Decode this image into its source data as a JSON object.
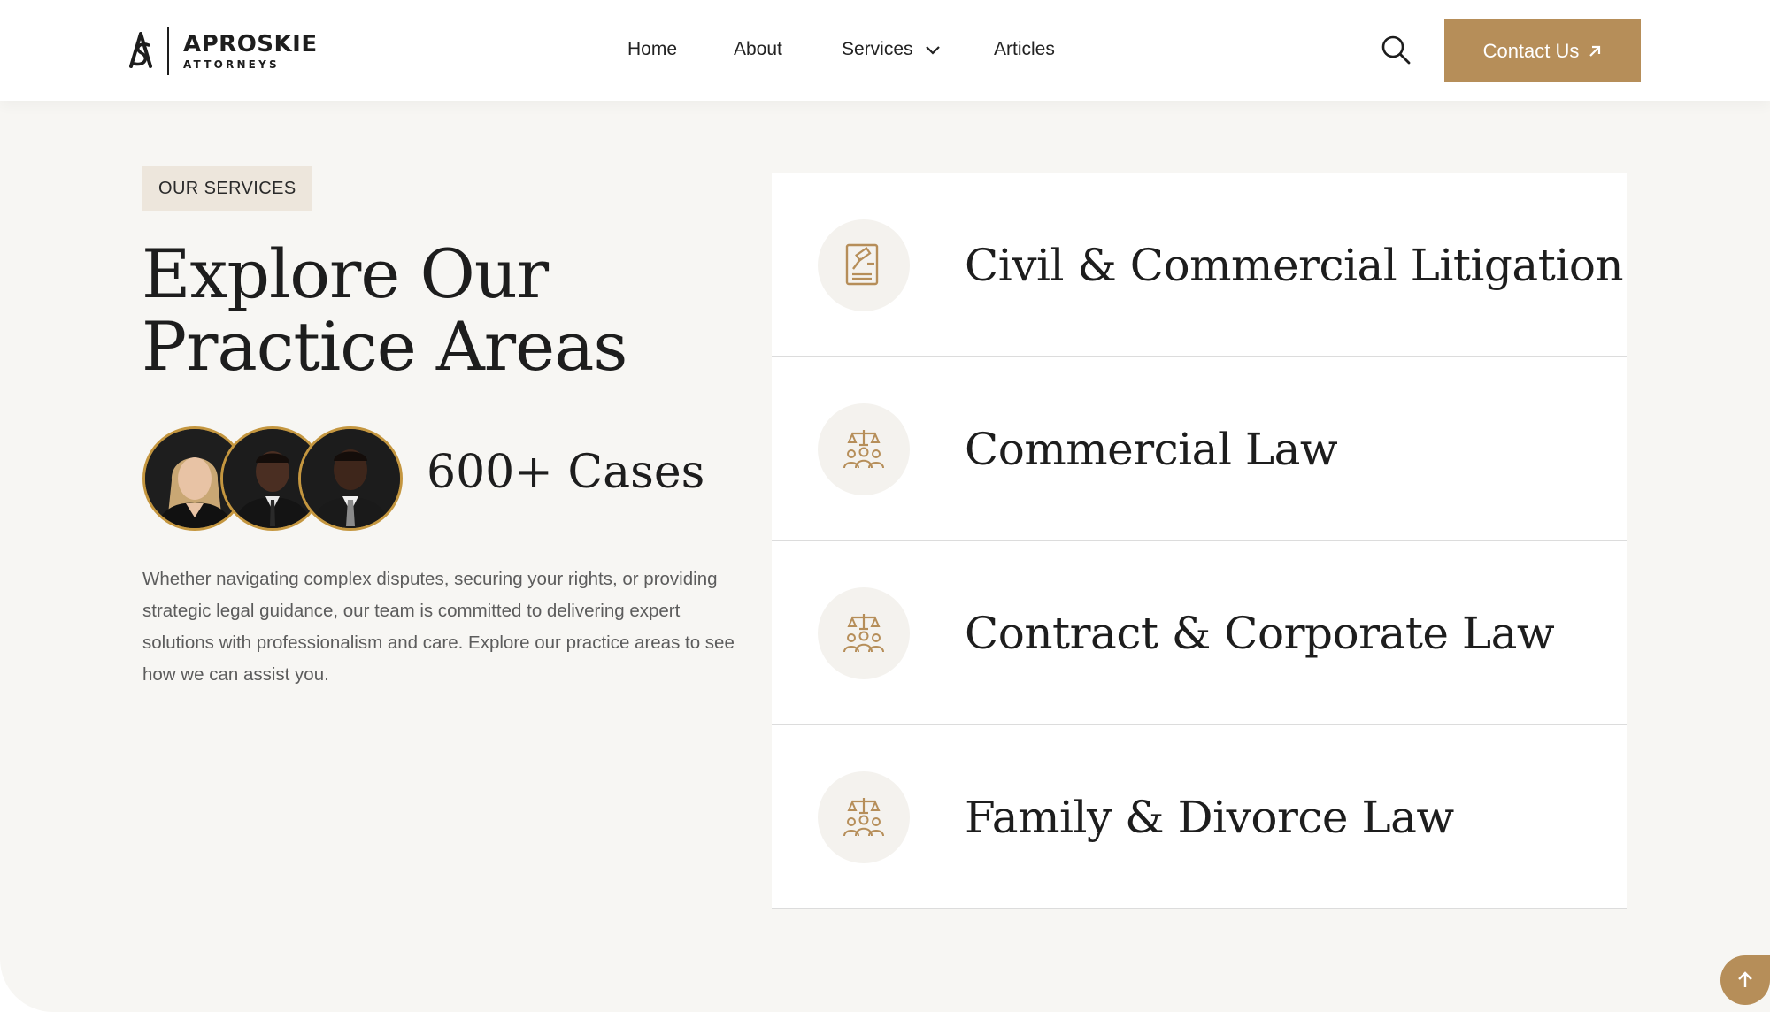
{
  "brand": {
    "name": "APROSKIE",
    "subtitle": "ATTORNEYS"
  },
  "nav": {
    "items": [
      {
        "label": "Home"
      },
      {
        "label": "About"
      },
      {
        "label": "Services"
      },
      {
        "label": "Articles"
      }
    ]
  },
  "header": {
    "contact_label": "Contact Us"
  },
  "section": {
    "tag": "OUR SERVICES",
    "heading_line1": "Explore Our",
    "heading_line2": "Practice Areas",
    "cases": "600+ Cases",
    "description": "Whether navigating complex disputes, securing your rights, or providing strategic legal guidance, our team is committed to delivering expert solutions with professionalism and care. Explore our practice areas to see how we can assist you."
  },
  "services": [
    {
      "title": "Civil & Commercial Litigation",
      "icon": "gavel-document-icon"
    },
    {
      "title": "Commercial Law",
      "icon": "scales-people-icon"
    },
    {
      "title": "Contract & Corporate Law",
      "icon": "scales-people-icon"
    },
    {
      "title": "Family & Divorce Law",
      "icon": "scales-people-icon"
    }
  ],
  "colors": {
    "accent": "#b68e59",
    "section_bg": "#f7f6f3",
    "tag_bg": "#ede6dc",
    "avatar_ring": "#c4963f"
  }
}
